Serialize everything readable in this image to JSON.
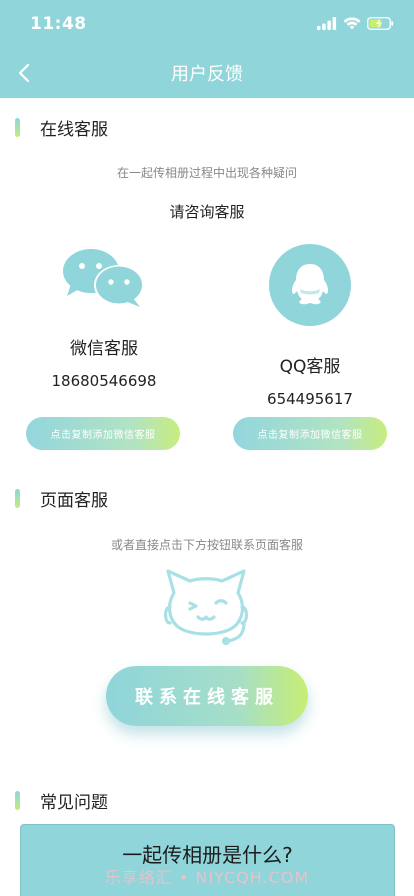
{
  "status_bar": {
    "time": "11:48"
  },
  "nav": {
    "title": "用户反馈"
  },
  "online_service": {
    "section_title": "在线客服",
    "hint": "在一起传相册过程中出现各种疑问",
    "prompt": "请咨询客服",
    "wechat": {
      "name": "微信客服",
      "number": "18680546698",
      "button": "点击复制添加微信客服"
    },
    "qq": {
      "name": "QQ客服",
      "number": "654495617",
      "button": "点击复制添加微信客服"
    }
  },
  "page_service": {
    "section_title": "页面客服",
    "hint": "或者直接点击下方按钮联系页面客服",
    "button": "联系在线客服"
  },
  "faq": {
    "section_title": "常见问题",
    "items": [
      "一起传相册是什么?"
    ]
  },
  "watermark": "乐享络汇 • NIYCQH.COM",
  "colors": {
    "accent": "#8fd5da",
    "accent_end": "#c8ee74"
  }
}
